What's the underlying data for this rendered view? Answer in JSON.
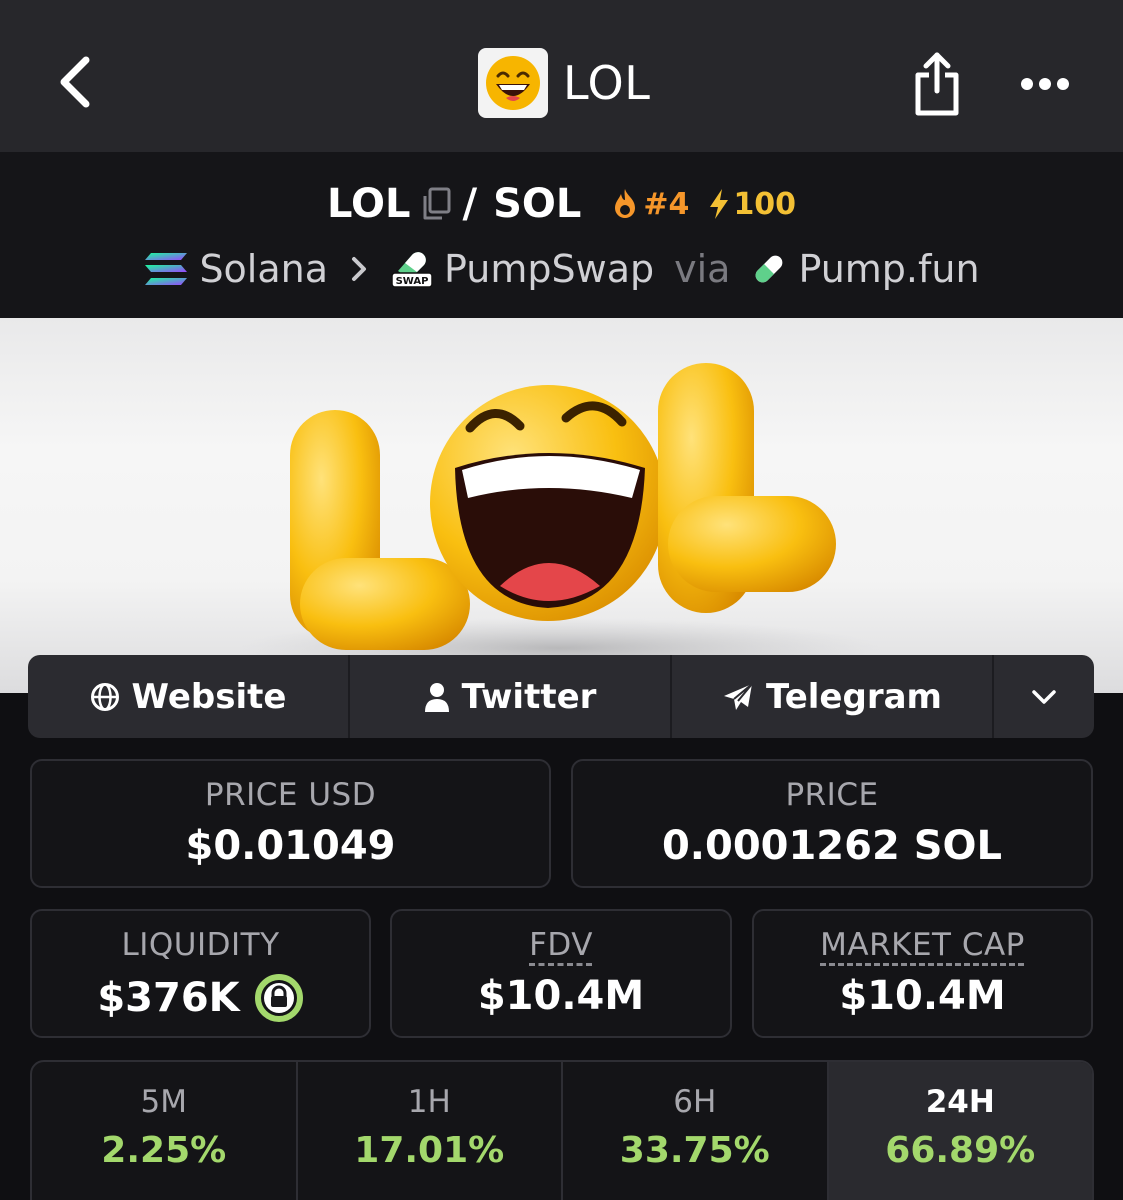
{
  "header": {
    "title": "LOL",
    "avatar_icon": "grinning-face-icon"
  },
  "pair": {
    "base": "LOL",
    "separator": "/",
    "quote": "SOL",
    "rank": "#4",
    "boost": "100",
    "chain": "Solana",
    "dex": "PumpSwap",
    "via": "via",
    "launchpad": "Pump.fun"
  },
  "banner": {
    "letters": [
      "L",
      "L"
    ],
    "colors": {
      "yellow": "#f7b500",
      "mouth": "#2a0d08",
      "tongue": "#e4464a"
    }
  },
  "links": {
    "website": "Website",
    "twitter": "Twitter",
    "telegram": "Telegram"
  },
  "stats": {
    "price_usd_label": "PRICE USD",
    "price_usd_value": "$0.01049",
    "price_label": "PRICE",
    "price_value": "0.0001262 SOL",
    "liquidity_label": "LIQUIDITY",
    "liquidity_value": "$376K",
    "fdv_label": "FDV",
    "fdv_value": "$10.4M",
    "mcap_label": "MARKET CAP",
    "mcap_value": "$10.4M"
  },
  "timeframes": [
    {
      "label": "5M",
      "value": "2.25%"
    },
    {
      "label": "1H",
      "value": "17.01%"
    },
    {
      "label": "6H",
      "value": "33.75%"
    },
    {
      "label": "24H",
      "value": "66.89%"
    }
  ],
  "colors": {
    "positive": "#a3d86c",
    "rank": "#f5962a",
    "boost": "#f3c034",
    "lock": "#a3d86c"
  }
}
